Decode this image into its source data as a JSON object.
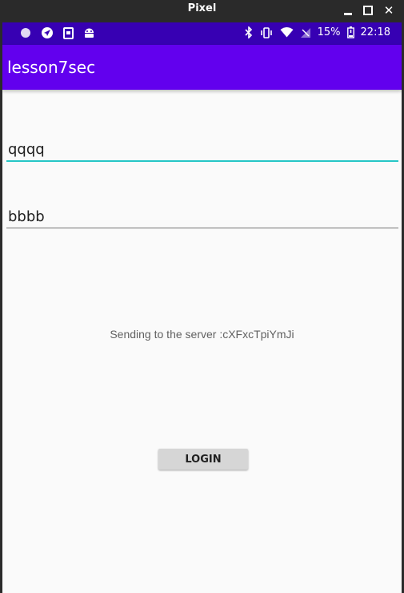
{
  "window": {
    "title": "Pixel",
    "close_glyph": "✕"
  },
  "statusbar": {
    "left_icons": [
      "circle-icon",
      "location-icon",
      "sd-card-icon",
      "android-icon"
    ],
    "right_icons": [
      "bluetooth-icon",
      "vibrate-icon",
      "wifi-icon",
      "signal-icon",
      "battery-icon"
    ],
    "battery_percent": "15%",
    "time": "22:18",
    "bar_color": "#3700b3"
  },
  "appbar": {
    "title": "lesson7sec",
    "color": "#6200ee"
  },
  "form": {
    "field1_value": "qqqq",
    "field2_value": "bbbb",
    "focus_color": "#26c6c6"
  },
  "message": {
    "text": "Sending to the server :cXFxcTpiYmJi"
  },
  "login_button": {
    "label": "LOGIN"
  }
}
